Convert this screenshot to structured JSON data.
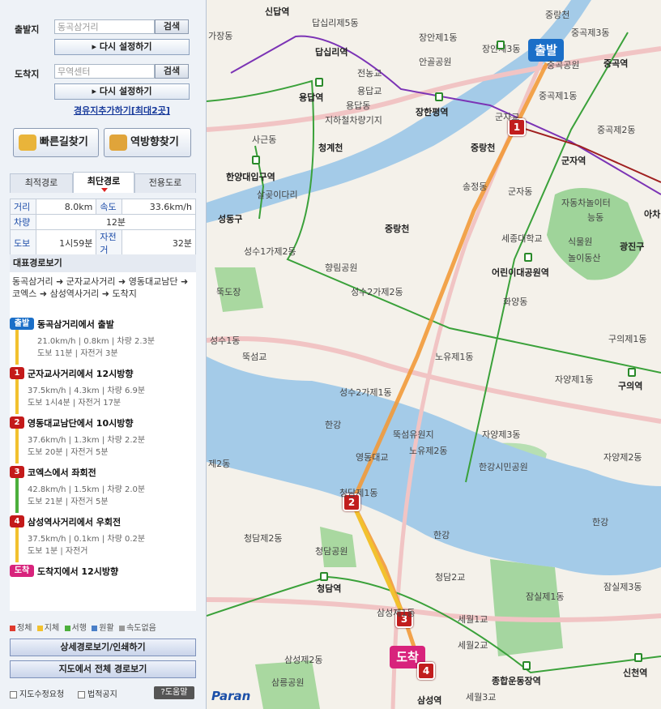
{
  "search": {
    "origin_label": "출발지",
    "origin_value": "동곡삼거리",
    "dest_label": "도착지",
    "dest_value": "무역센터",
    "search_btn": "검색",
    "reset_btn": "▸ 다시 설정하기",
    "add_waypoint": "경유지추가하기[최대2곳]",
    "fast_route_btn": "빠른길찾기",
    "reverse_btn": "역방향찾기"
  },
  "tabs": [
    "최적경로",
    "최단경로",
    "전용도로"
  ],
  "active_tab": 1,
  "stats": {
    "distance_label": "거리",
    "distance": "8.0km",
    "speed_label": "속도",
    "speed": "33.6km/h",
    "car_label": "차량",
    "car": "12분",
    "walk_label": "도보",
    "walk": "1시59분",
    "bike_label": "자전거",
    "bike": "32분"
  },
  "route": {
    "header": "대표경로보기",
    "summary": "동곡삼거리 ➜ 군자교사거리 ➜ 영동대교남단 ➜ 코엑스 ➜ 삼성역사거리 ➜ 도착지",
    "steps": [
      {
        "badge": "출발",
        "title": "동곡삼거리에서 출발",
        "detail1": "21.0km/h | 0.8km | 차량 2.3분",
        "detail2": "도보 11분 | 자전거 3분"
      },
      {
        "badge": "1",
        "title": "군자교사거리에서 12시방향",
        "detail1": "37.5km/h | 4.3km | 차량 6.9분",
        "detail2": "도보 1시4분 | 자전거 17분"
      },
      {
        "badge": "2",
        "title": "영동대교남단에서 10시방향",
        "detail1": "37.6km/h | 1.3km | 차량 2.2분",
        "detail2": "도보 20분 | 자전거 5분"
      },
      {
        "badge": "3",
        "title": "코엑스에서 좌회전",
        "detail1": "42.8km/h | 1.5km | 차량 2.0분",
        "detail2": "도보 21분 | 자전거 5분"
      },
      {
        "badge": "4",
        "title": "삼성역사거리에서 우회전",
        "detail1": "37.5km/h | 0.1km | 차량 0.2분",
        "detail2": "도보 1분 | 자전거"
      },
      {
        "badge": "도착",
        "title": "도착지에서 12시방향",
        "detail1": "",
        "detail2": ""
      }
    ]
  },
  "legend": [
    {
      "label": "정체",
      "color": "#e03b2e"
    },
    {
      "label": "지체",
      "color": "#f2c12e"
    },
    {
      "label": "서행",
      "color": "#4caf3c"
    },
    {
      "label": "원활",
      "color": "#4a7fc8"
    },
    {
      "label": "속도없음",
      "color": "#999999"
    }
  ],
  "buttons": {
    "detail": "상세경로보기/인쇄하기",
    "full_map": "지도에서 전체 경로보기"
  },
  "footer": {
    "report": "지도수정요청",
    "legal": "법적공지",
    "help": "?도움말",
    "brand": "Paran"
  },
  "map": {
    "start_marker": "출발",
    "end_marker": "도착",
    "labels": [
      "신답역",
      "중랑천",
      "답십리제5동",
      "중곡제3동",
      "가장동",
      "장안제1동",
      "장안제3동",
      "중곡역",
      "중곡공원",
      "답십리역",
      "전농교",
      "안골공원",
      "용답역",
      "용답교",
      "장한평역",
      "군자교",
      "중곡제1동",
      "용답동",
      "지하철차량기지",
      "중곡제2동",
      "사근동",
      "청계천",
      "중랑천",
      "군자역",
      "한양대입구역",
      "송정동",
      "군자동",
      "자동차놀이터",
      "살곶이다리",
      "능동",
      "아차",
      "성동구",
      "중랑천",
      "세종대학교",
      "광진구",
      "식물원",
      "놀이동산",
      "성수1가제2동",
      "향림공원",
      "어린이대공원역",
      "뚝도장",
      "성수2가제2동",
      "화양동",
      "구의제1동",
      "성수1동",
      "뚝섬교",
      "노유제1동",
      "자양제1동",
      "구의역",
      "성수2가제1동",
      "한강",
      "뚝섬유원지",
      "노유제2동",
      "자양제3동",
      "영동대교",
      "한강시민공원",
      "자양제2동",
      "청담제1동",
      "제2동",
      "청담제2동",
      "한강",
      "한강",
      "청담공원",
      "청담2교",
      "잠실제3동",
      "청담역",
      "잠실제1동",
      "삼성제1동",
      "세월1교",
      "세월2교",
      "삼성제2동",
      "종합운동장역",
      "신천역",
      "삼릉공원",
      "삼성역",
      "세월3교"
    ]
  }
}
